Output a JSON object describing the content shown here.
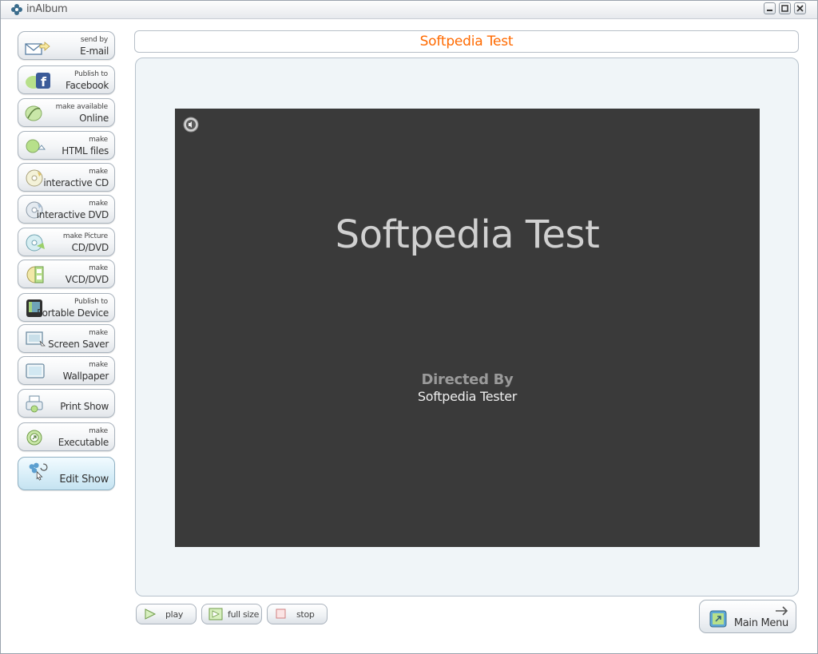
{
  "window": {
    "title": "inAlbum"
  },
  "sidebar": {
    "items": [
      {
        "line1": "send by",
        "line2": "E-mail",
        "icon": "email-icon"
      },
      {
        "line1": "Publish to",
        "line2": "Facebook",
        "icon": "facebook-icon"
      },
      {
        "line1": "make available",
        "line2": "Online",
        "icon": "online-icon"
      },
      {
        "line1": "make",
        "line2": "HTML files",
        "icon": "html-files-icon"
      },
      {
        "line1": "make",
        "line2": "interactive CD",
        "icon": "cd-icon"
      },
      {
        "line1": "make",
        "line2": "interactive DVD",
        "icon": "dvd-icon"
      },
      {
        "line1": "make Picture",
        "line2": "CD/DVD",
        "icon": "picture-disc-icon"
      },
      {
        "line1": "make",
        "line2": "VCD/DVD",
        "icon": "vcd-icon"
      },
      {
        "line1": "Publish to",
        "line2": "Portable Device",
        "icon": "portable-device-icon"
      },
      {
        "line1": "make",
        "line2": "Screen Saver",
        "icon": "screen-saver-icon"
      },
      {
        "line1": "make",
        "line2": "Wallpaper",
        "icon": "wallpaper-icon"
      },
      {
        "line1": "",
        "line2": "Print Show",
        "icon": "printer-icon"
      },
      {
        "line1": "make",
        "line2": "Executable",
        "icon": "executable-icon"
      },
      {
        "line1": "",
        "line2": "Edit Show",
        "icon": "edit-show-icon"
      }
    ]
  },
  "header": {
    "show_title": "Softpedia Test"
  },
  "preview": {
    "title": "Softpedia Test",
    "directed_by": "Directed By",
    "director": "Softpedia Tester"
  },
  "playback": {
    "play": "play",
    "full_size": "full size",
    "stop": "stop"
  },
  "main_menu": {
    "label": "Main Menu"
  },
  "colors": {
    "title_accent": "#ff6a00",
    "screen_bg": "#3a3a3a"
  }
}
